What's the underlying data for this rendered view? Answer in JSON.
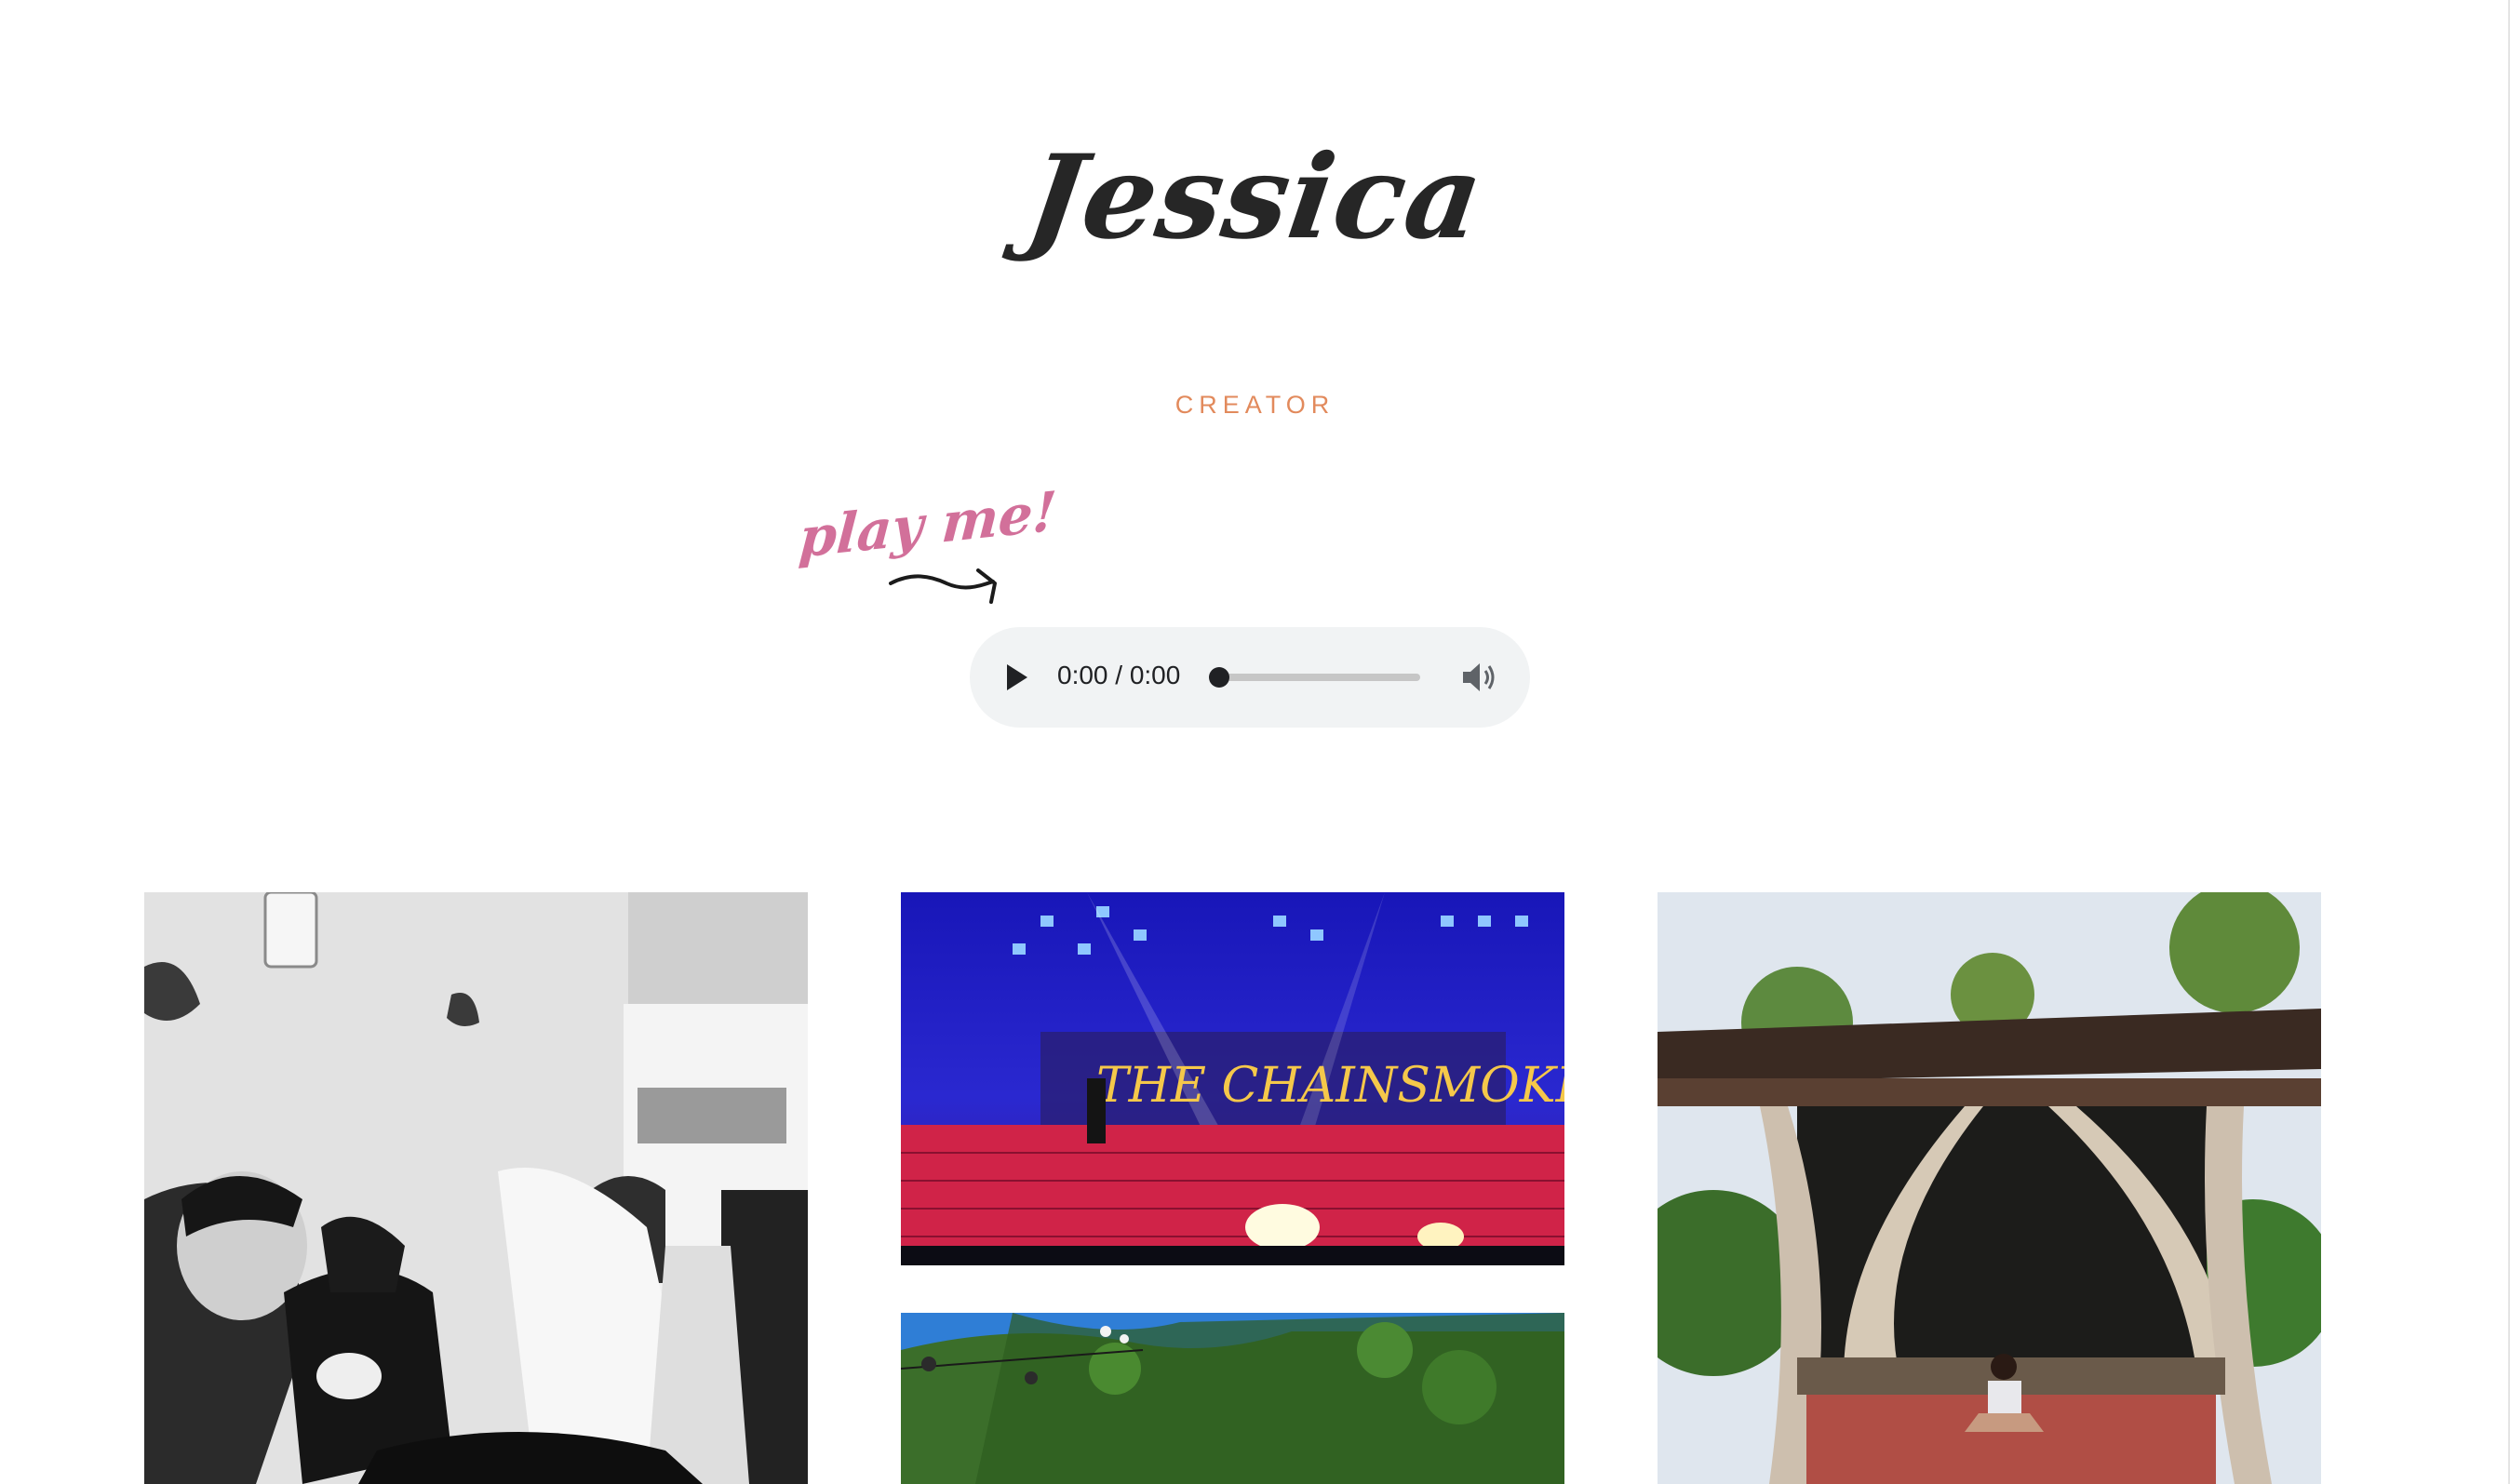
{
  "header": {
    "title": "Jessica",
    "subtitle": "CREATOR"
  },
  "player": {
    "hint": "play me!",
    "time": "0:00 / 0:00"
  },
  "icons": {
    "arrow": "curved-arrow-icon",
    "play": "play-icon",
    "volume": "volume-icon"
  },
  "gallery": {
    "photos": [
      {
        "id": "photo-1",
        "tone": "black-and-white"
      },
      {
        "id": "photo-2",
        "tone": "color"
      },
      {
        "id": "photo-3",
        "tone": "color"
      },
      {
        "id": "photo-4",
        "tone": "color"
      }
    ]
  },
  "colors": {
    "subtitle": "#e28a5c",
    "hint": "#d2709a",
    "title": "#262626",
    "player_bg": "#f1f3f4"
  }
}
